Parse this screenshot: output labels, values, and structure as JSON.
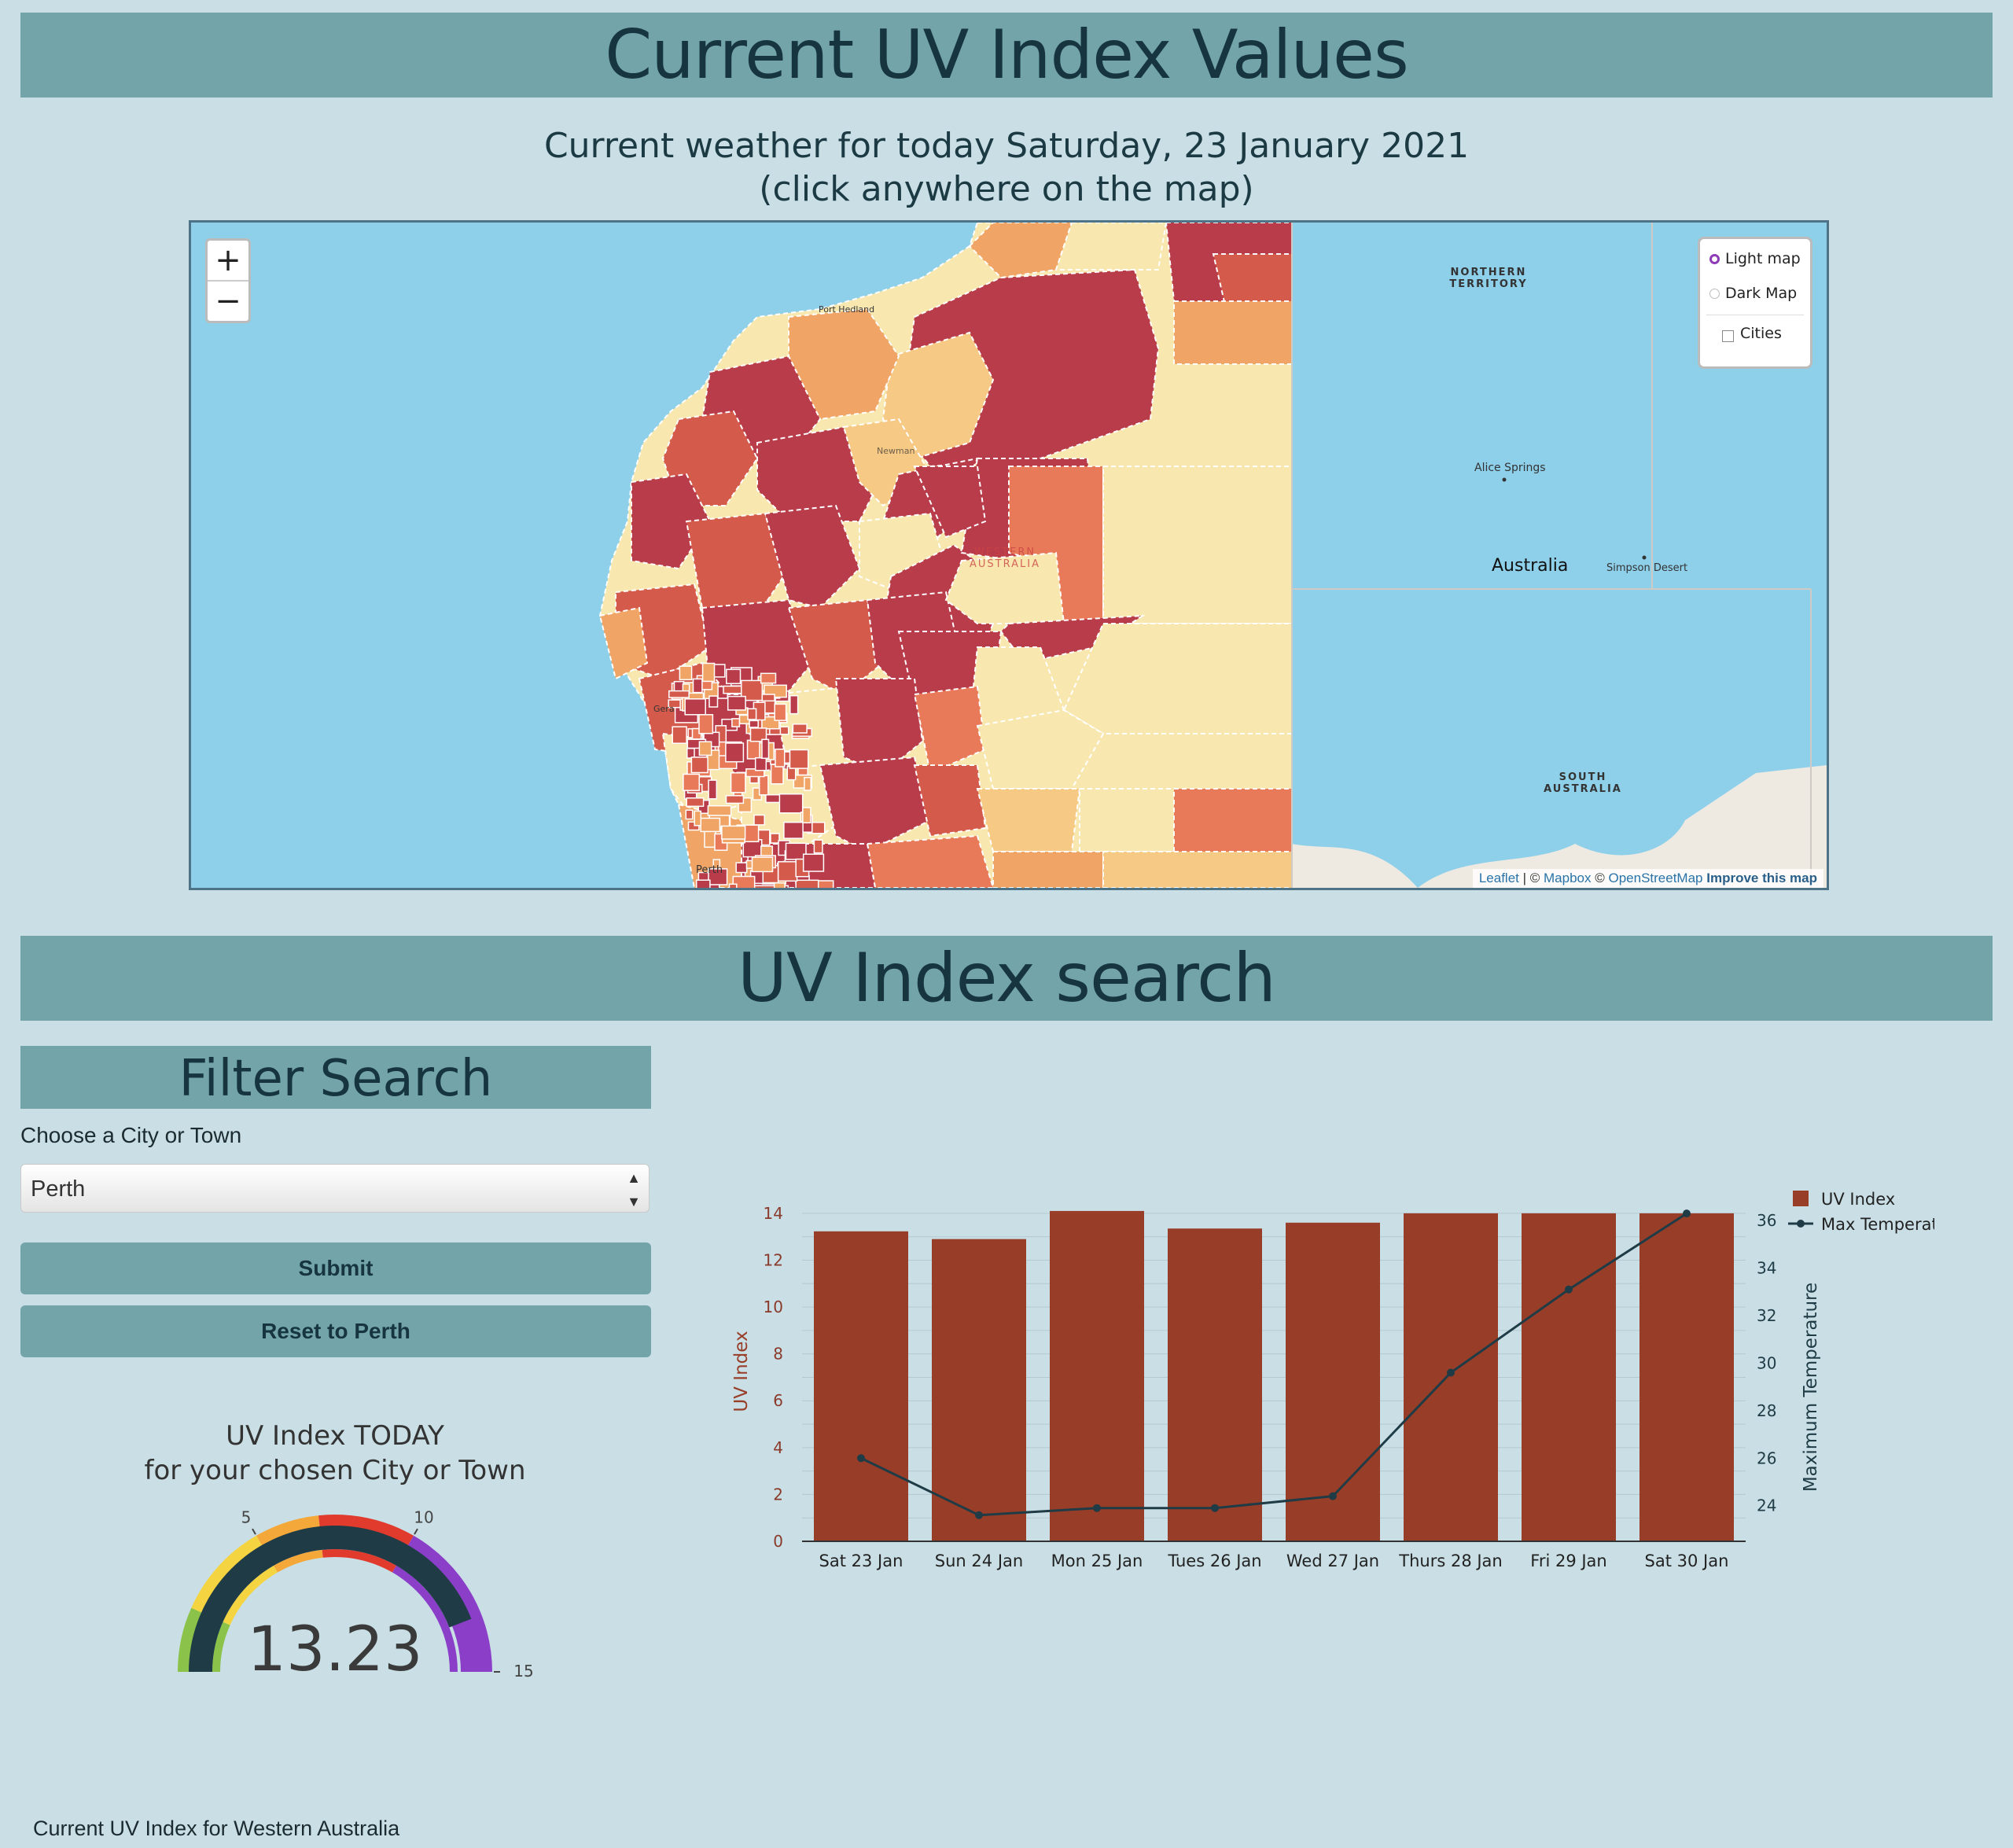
{
  "header": {
    "title": "Current UV Index Values"
  },
  "subtitle": {
    "line1": "Current weather for today Saturday, 23 January 2021",
    "line2": "(click anywhere on the map)"
  },
  "map": {
    "zoom_in": "+",
    "zoom_out": "−",
    "layers": {
      "light": "Light map",
      "dark": "Dark Map",
      "cities": "Cities",
      "selected": "Light map"
    },
    "labels": {
      "nt": "NORTHERN TERRITORY",
      "alice": "Alice Springs",
      "australia": "Australia",
      "simpson": "Simpson Desert",
      "sa": "SOUTH AUSTRALIA",
      "wa": "WESTERN AUSTRALIA",
      "port_hedland": "Port Hedland",
      "newman": "Newman",
      "geraldton": "Gera",
      "perth": "Perth"
    },
    "attribution": {
      "leaflet": "Leaflet",
      "sep1": " | © ",
      "mapbox": "Mapbox",
      "sep2": " © ",
      "osm": "OpenStreetMap",
      "improve": "Improve this map"
    },
    "colors": [
      "#b83c4a",
      "#d45a4c",
      "#e87a5a",
      "#f0a566",
      "#f6c985",
      "#f8e8b0"
    ]
  },
  "search": {
    "title": "UV Index search",
    "filter_title": "Filter Search",
    "choose_label": "Choose a City or Town",
    "selected_city": "Perth",
    "submit": "Submit",
    "reset": "Reset to Perth"
  },
  "gauge": {
    "title_line1": "UV Index TODAY",
    "title_line2": "for your chosen City or Town",
    "value": 13.23,
    "value_text": "13.23",
    "min": 0,
    "max": 15,
    "ticks": [
      "5",
      "10",
      "15"
    ],
    "bands": [
      {
        "from": 0,
        "to": 2,
        "color": "#8bc34a"
      },
      {
        "from": 2,
        "to": 5,
        "color": "#f5d442"
      },
      {
        "from": 5,
        "to": 7,
        "color": "#f4a83a"
      },
      {
        "from": 7,
        "to": 10,
        "color": "#e03b2d"
      },
      {
        "from": 10,
        "to": 15,
        "color": "#8b3fc9"
      }
    ],
    "bar_color": "#1f3b46"
  },
  "chart_data": {
    "type": "bar",
    "categories": [
      "Sat 23 Jan",
      "Sun 24 Jan",
      "Mon 25 Jan",
      "Tues 26 Jan",
      "Wed 27 Jan",
      "Thurs 28 Jan",
      "Fri 29 Jan",
      "Sat 30 Jan"
    ],
    "series": [
      {
        "name": "UV Index",
        "type": "bar",
        "axis": "left",
        "color": "#983d28",
        "values": [
          13.23,
          12.9,
          14.1,
          13.35,
          13.6,
          14.0,
          14.0,
          14.0
        ]
      },
      {
        "name": "Max Temperature",
        "type": "line",
        "axis": "right",
        "color": "#1f3b46",
        "values": [
          26.0,
          23.6,
          23.9,
          23.9,
          24.4,
          29.6,
          33.1,
          36.3
        ]
      }
    ],
    "ylabel": "UV Index",
    "y2label": "Maximum Temperature",
    "ylim": [
      0,
      14.5
    ],
    "y2lim": [
      22.5,
      36.8
    ],
    "yticks": [
      0,
      2,
      4,
      6,
      8,
      10,
      12,
      14
    ],
    "y2ticks": [
      24,
      26,
      28,
      30,
      32,
      34,
      36
    ],
    "legend": "top-right",
    "grid": true
  },
  "footer": {
    "text": "Current UV Index for Western Australia"
  }
}
